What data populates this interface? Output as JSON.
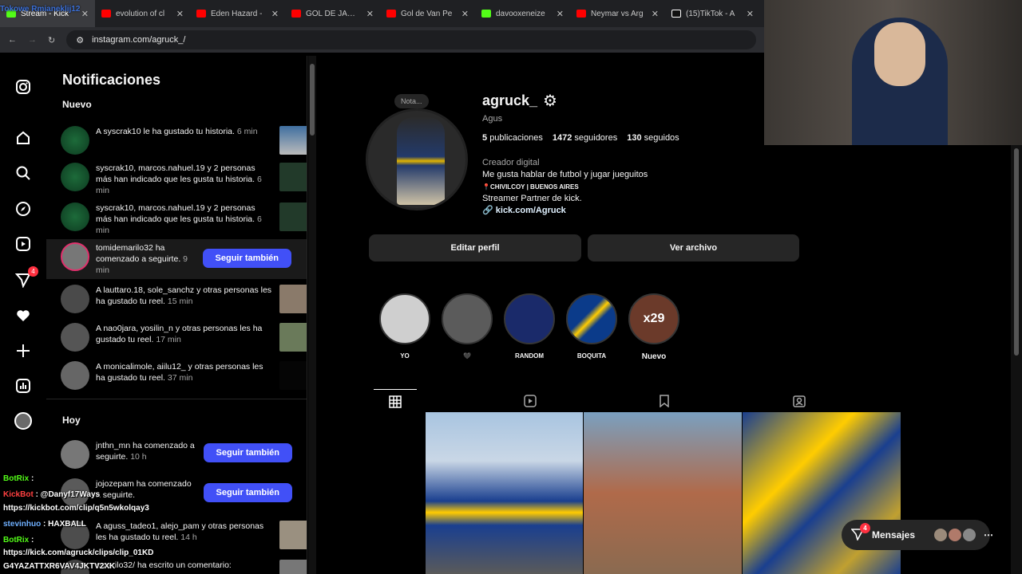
{
  "browser": {
    "tabs": [
      {
        "title": "Stream - Kick",
        "icon": "kick",
        "active": true
      },
      {
        "title": "evolution of cl",
        "icon": "yt"
      },
      {
        "title": "Eden Hazard -",
        "icon": "yt"
      },
      {
        "title": "GOL DE JAMES",
        "icon": "yt"
      },
      {
        "title": "Gol de Van Pe",
        "icon": "yt"
      },
      {
        "title": "davooxeneize",
        "icon": "kick"
      },
      {
        "title": "Neymar vs Arg",
        "icon": "yt"
      },
      {
        "title": "(15)TikTok - A",
        "icon": "tt"
      }
    ],
    "url": "instagram.com/agruck_/",
    "overlay_text": "Tokowe Rmianeklij12"
  },
  "notifications": {
    "title": "Notificaciones",
    "section_new": "Nuevo",
    "section_today": "Hoy",
    "items": [
      {
        "text": "A syscrak10 le ha gustado tu historia.",
        "time": "6 min"
      },
      {
        "text": "syscrak10, marcos.nahuel.19 y 2 personas más han indicado que les gusta tu historia.",
        "time": "6 min"
      },
      {
        "text": "syscrak10, marcos.nahuel.19 y 2 personas más han indicado que les gusta tu historia.",
        "time": "6 min"
      },
      {
        "text": "tomidemarilo32 ha comenzado a seguirte.",
        "time": "9 min",
        "button": "Seguir también"
      },
      {
        "text": "A lauttaro.18, sole_sanchz y otras personas les ha gustado tu reel.",
        "time": "15 min"
      },
      {
        "text": "A nao0jara, yosilin_n y otras personas les ha gustado tu reel.",
        "time": "17 min"
      },
      {
        "text": "A monicalimole, aiilu12_ y otras personas les ha gustado tu reel.",
        "time": "37 min"
      }
    ],
    "today_items": [
      {
        "text": "jnthn_mn ha comenzado a seguirte.",
        "time": "10 h",
        "button": "Seguir también"
      },
      {
        "text": "jojozepam ha comenzado a seguirte.",
        "time": "",
        "button": "Seguir también"
      },
      {
        "text": "A aguss_tadeo1, alejo_pam y otras personas les ha gustado tu reel.",
        "time": "14 h"
      },
      {
        "text": "emarilo32/ ha escrito un comentario:",
        "time": ""
      }
    ]
  },
  "profile": {
    "note": "Nota...",
    "username": "agruck_",
    "fullname": "Agus",
    "posts": "5",
    "posts_label": "publicaciones",
    "followers": "1472",
    "followers_label": "seguidores",
    "following": "130",
    "following_label": "seguidos",
    "category": "Creador digital",
    "bio_line1": "Me gusta hablar de futbol y jugar jueguitos",
    "bio_line2": "📍CHIVILCOY | BUENOS AIRES",
    "bio_line3": "Streamer Partner de kick.",
    "link": "kick.com/Agruck",
    "edit_button": "Editar perfil",
    "archive_button": "Ver archivo",
    "highlights": [
      {
        "label": "YO"
      },
      {
        "label": "🖤"
      },
      {
        "label": "RANDOM"
      },
      {
        "label": "BOQUITA"
      },
      {
        "label": "Nuevo",
        "cover_text": "x29"
      }
    ]
  },
  "messages": {
    "label": "Mensajes",
    "badge": "4"
  },
  "nav": {
    "notif_badge": "4"
  },
  "chat": [
    {
      "user": "BotRix",
      "msg": ":",
      "color": "green"
    },
    {
      "user": "KickBot",
      "msg": ": @Danyf17Ways",
      "color": "red"
    },
    {
      "user": "",
      "msg": "https://kickbot.com/clip/q5n5wkolqay3",
      "color": ""
    },
    {
      "user": "stevinhuo",
      "msg": ": HAXBALL",
      "color": "blue"
    },
    {
      "user": "BotRix",
      "msg": ":",
      "color": "green"
    },
    {
      "user": "",
      "msg": "https://kick.com/agruck/clips/clip_01KD",
      "color": ""
    },
    {
      "user": "",
      "msg": "G4YAZATTXR6VAV4JKTV2XK",
      "color": ""
    }
  ],
  "colors": {
    "accent": "#4150f7",
    "badge": "#ff3040",
    "kick": "#53fc18"
  }
}
